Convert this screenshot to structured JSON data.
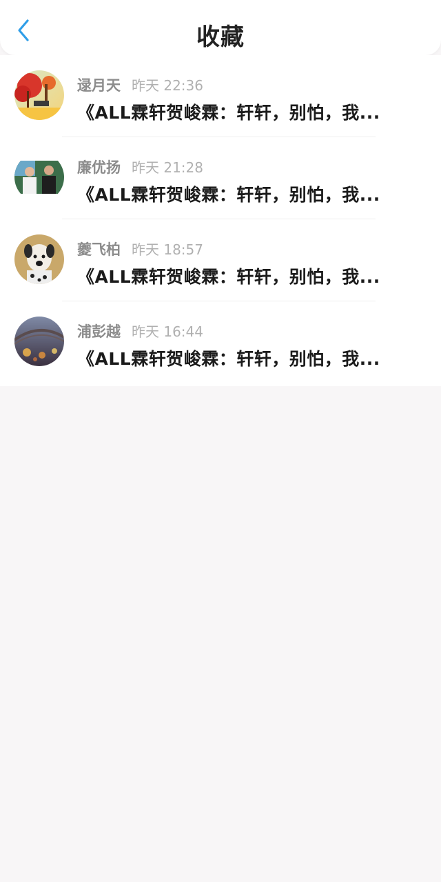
{
  "header": {
    "title": "收藏",
    "back_icon": "chevron-left-icon",
    "accent_color": "#2f9ee8"
  },
  "favorites": [
    {
      "name": "逯月天",
      "time": "昨天 22:36",
      "content": "《ALL霖轩贺峻霖：轩轩，别怕，我..."
    },
    {
      "name": "廉优扬",
      "time": "昨天 21:28",
      "content": "《ALL霖轩贺峻霖：轩轩，别怕，我..."
    },
    {
      "name": "夔飞柏",
      "time": "昨天 18:57",
      "content": "《ALL霖轩贺峻霖：轩轩，别怕，我..."
    },
    {
      "name": "浦彭越",
      "time": "昨天 16:44",
      "content": "《ALL霖轩贺峻霖：轩轩，别怕，我..."
    }
  ]
}
